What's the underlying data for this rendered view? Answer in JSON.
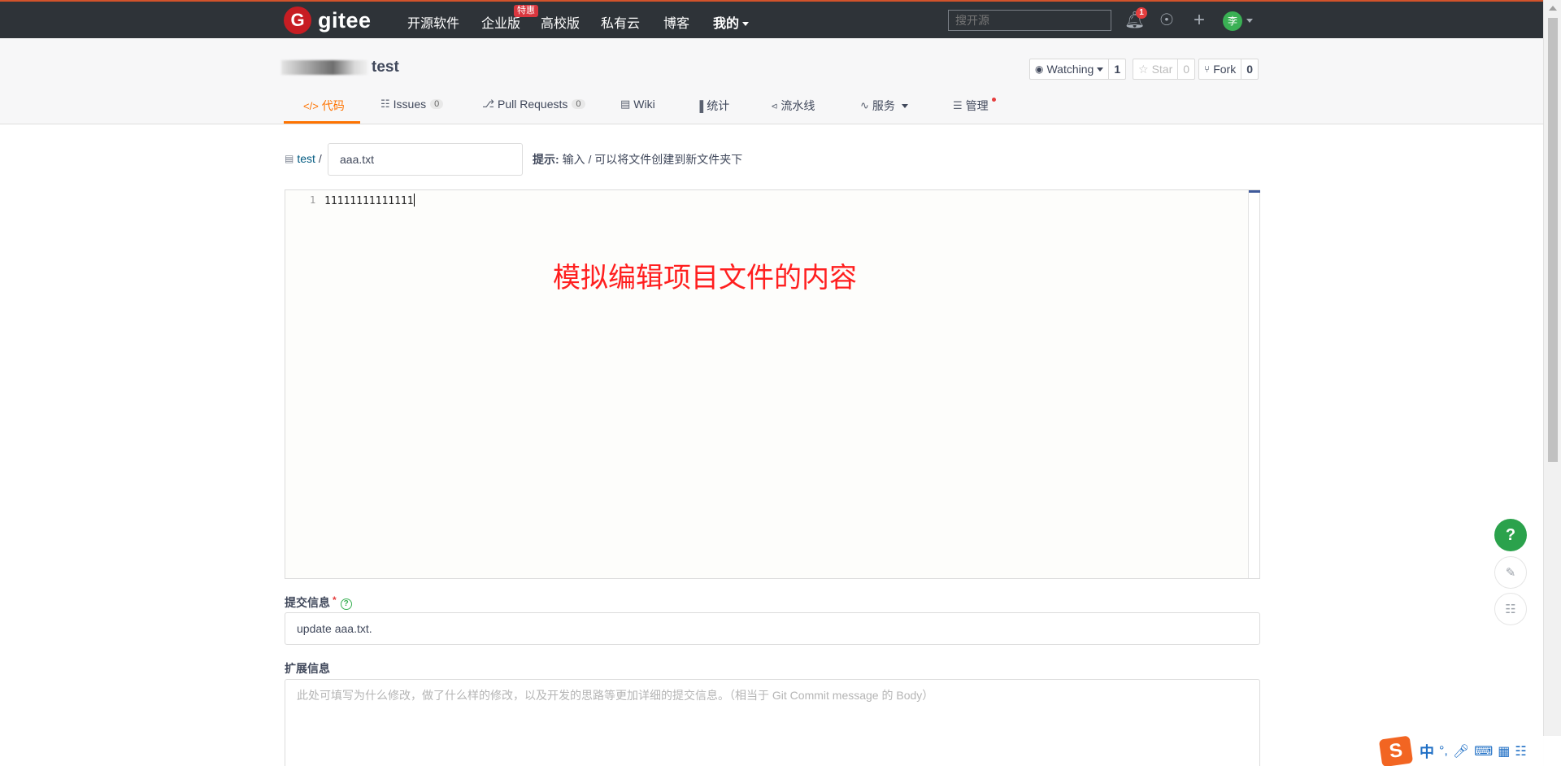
{
  "topbar": {
    "logo_mark": "G",
    "logo_text": "gitee",
    "nav": [
      "开源软件",
      "企业版",
      "高校版",
      "私有云",
      "博客",
      "我的"
    ],
    "enterprise_badge": "特惠",
    "search_placeholder": "搜开源",
    "notification_count": "1",
    "avatar_text": "李",
    "colors": {
      "background": "#2e3338",
      "accent_border": "#d2532b"
    }
  },
  "repo": {
    "name": "test",
    "watching_label": "Watching",
    "watching_count": "1",
    "star_label": "Star",
    "star_count": "0",
    "fork_label": "Fork",
    "fork_count": "0"
  },
  "tabs": {
    "code": "代码",
    "issues": "Issues",
    "issues_count": "0",
    "pulls": "Pull Requests",
    "pulls_count": "0",
    "wiki": "Wiki",
    "stats": "统计",
    "pipeline": "流水线",
    "services": "服务",
    "manage": "管理",
    "active_color": "#fe7300"
  },
  "editor_page": {
    "breadcrumb_repo": "test",
    "breadcrumb_sep": "/",
    "filename_value": "aaa.txt",
    "hint_label": "提示:",
    "hint_text": "输入 / 可以将文件创建到新文件夹下",
    "line_number": "1",
    "line_content": "11111111111111",
    "annotation": "模拟编辑项目文件的内容",
    "annotation_color": "#ff1f1f",
    "commit_label": "提交信息",
    "commit_required": "*",
    "commit_value": "update aaa.txt.",
    "ext_label": "扩展信息",
    "ext_placeholder": "此处可填写为什么修改，做了什么样的修改，以及开发的思路等更加详细的提交信息。（相当于 Git Commit message 的 Body）"
  },
  "floating": {
    "help": "?",
    "edit_icon": "edit-icon",
    "chat_icon": "chat-icon"
  },
  "ime": {
    "logo": "S",
    "lang": "中",
    "punct": "°,"
  }
}
